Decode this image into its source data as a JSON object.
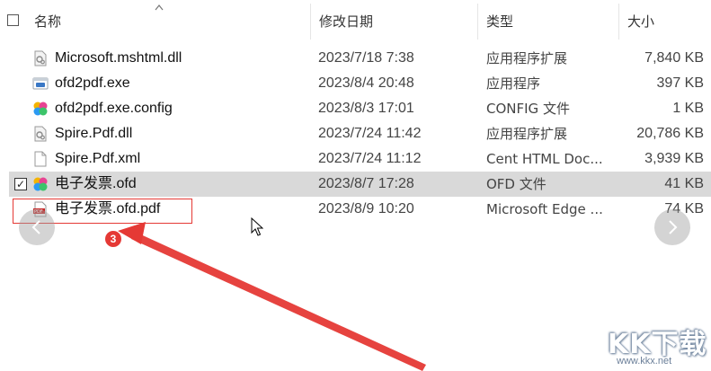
{
  "header": {
    "name_label": "名称",
    "date_label": "修改日期",
    "type_label": "类型",
    "size_label": "大小"
  },
  "files": [
    {
      "name": "Microsoft.mshtml.dll",
      "date": "2023/7/18 7:38",
      "type": "应用程序扩展",
      "size": "7,840 KB",
      "icon": "dll-file-icon"
    },
    {
      "name": "ofd2pdf.exe",
      "date": "2023/8/4 20:48",
      "type": "应用程序",
      "size": "397 KB",
      "icon": "exe-file-icon"
    },
    {
      "name": "ofd2pdf.exe.config",
      "date": "2023/8/3 17:01",
      "type": "CONFIG 文件",
      "size": "1 KB",
      "icon": "ofd-color-icon"
    },
    {
      "name": "Spire.Pdf.dll",
      "date": "2023/7/24 11:42",
      "type": "应用程序扩展",
      "size": "20,786 KB",
      "icon": "dll-file-icon"
    },
    {
      "name": "Spire.Pdf.xml",
      "date": "2023/7/24 11:12",
      "type": "Cent HTML Doc...",
      "size": "3,939 KB",
      "icon": "blank-file-icon"
    },
    {
      "name": "电子发票.ofd",
      "date": "2023/8/7 17:28",
      "type": "OFD 文件",
      "size": "41 KB",
      "icon": "ofd-color-icon",
      "selected": true
    },
    {
      "name": "电子发票.ofd.pdf",
      "date": "2023/8/9 10:20",
      "type": "Microsoft Edge ...",
      "size": "74 KB",
      "icon": "pdf-file-icon"
    }
  ],
  "annotation": {
    "step_number": "3",
    "color": "#e53935"
  },
  "selected_row_color": "#d9d9d9",
  "watermark": {
    "logo": "KK下载",
    "url": "www.kkx.net"
  }
}
